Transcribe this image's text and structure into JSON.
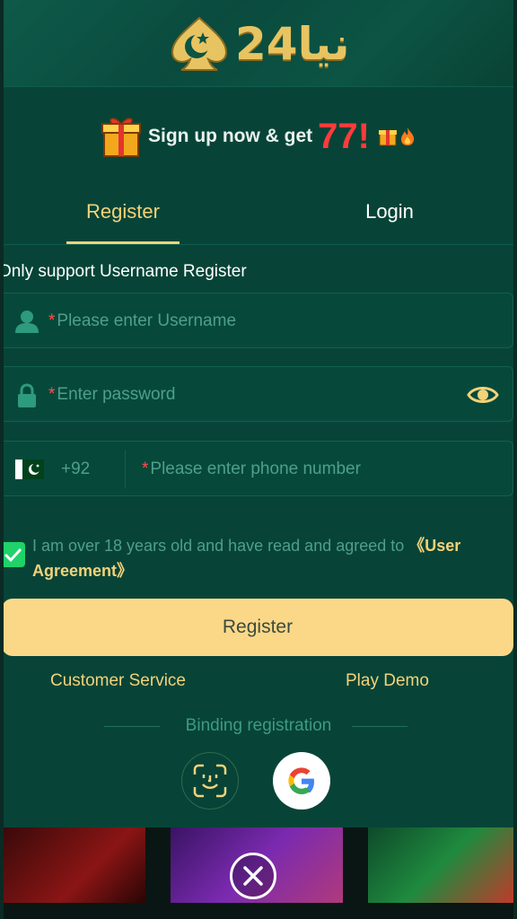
{
  "brand": {
    "logo_text": "نیا24"
  },
  "promo": {
    "text": "Sign up now & get",
    "amount": "77!"
  },
  "tabs": {
    "register": "Register",
    "login": "Login"
  },
  "form": {
    "notice": "Only support Username Register",
    "username": {
      "placeholder": "Please enter Username",
      "icon": "user-icon"
    },
    "password": {
      "placeholder": "Enter password",
      "icon": "lock-icon",
      "toggle_icon": "eye-icon"
    },
    "phone": {
      "country_code": "+92",
      "placeholder": "Please enter phone number",
      "flag": "pakistan-flag-icon"
    },
    "agreement": {
      "text": "I am over 18 years old and have read and agreed to ",
      "link": "《User Agreement》",
      "checked": true
    },
    "submit_label": "Register"
  },
  "links": {
    "customer_service": "Customer Service",
    "play_demo": "Play Demo"
  },
  "binding": {
    "label": "Binding registration",
    "options": [
      "face-id-icon",
      "google-icon"
    ]
  },
  "colors": {
    "background": "#074437",
    "accent": "#f3d27a",
    "button": "#fbd888",
    "promo_amount": "#ff3b3b",
    "placeholder": "#4f9f8a"
  }
}
